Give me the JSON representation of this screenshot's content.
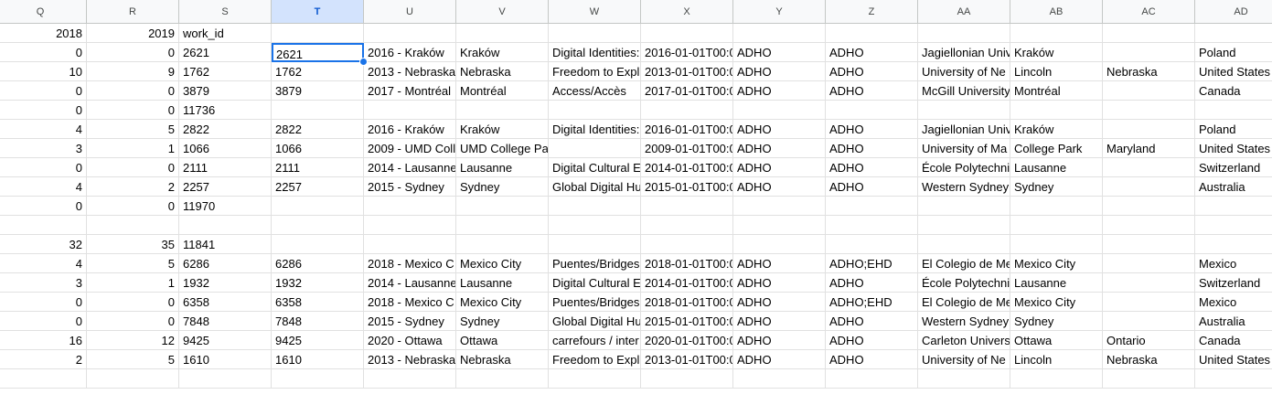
{
  "app": {
    "accent_color": "#1a73e8",
    "selected_header_bg": "#d3e3fd"
  },
  "columns": [
    "Q",
    "R",
    "S",
    "T",
    "U",
    "V",
    "W",
    "X",
    "Y",
    "Z",
    "AA",
    "AB",
    "AC",
    "AD"
  ],
  "selected_column": "T",
  "active_cell": {
    "row": 1,
    "col": 3
  },
  "rows": [
    [
      "2018",
      "2019",
      "work_id",
      "",
      "",
      "",
      "",
      "",
      "",
      "",
      "",
      "",
      "",
      ""
    ],
    [
      "0",
      "0",
      "2621",
      "2621",
      "2016 - Kraków",
      "Kraków",
      "Digital Identities:",
      "2016-01-01T00:0",
      "ADHO",
      "ADHO",
      "Jagiellonian Univ",
      "Kraków",
      "",
      "Poland"
    ],
    [
      "10",
      "9",
      "1762",
      "1762",
      "2013 - Nebraska",
      "Nebraska",
      "Freedom to Expl",
      "2013-01-01T00:0",
      "ADHO",
      "ADHO",
      "University of Ne",
      "Lincoln",
      "Nebraska",
      "United States"
    ],
    [
      "0",
      "0",
      "3879",
      "3879",
      "2017 - Montréal",
      "Montréal",
      "Access/Accès",
      "2017-01-01T00:0",
      "ADHO",
      "ADHO",
      "McGill University",
      "Montréal",
      "",
      "Canada"
    ],
    [
      "0",
      "0",
      "11736",
      "",
      "",
      "",
      "",
      "",
      "",
      "",
      "",
      "",
      "",
      ""
    ],
    [
      "4",
      "5",
      "2822",
      "2822",
      "2016 - Kraków",
      "Kraków",
      "Digital Identities:",
      "2016-01-01T00:0",
      "ADHO",
      "ADHO",
      "Jagiellonian Univ",
      "Kraków",
      "",
      "Poland"
    ],
    [
      "3",
      "1",
      "1066",
      "1066",
      "2009 - UMD Coll",
      "UMD College Pa",
      "",
      "2009-01-01T00:0",
      "ADHO",
      "ADHO",
      "University of Ma",
      "College Park",
      "Maryland",
      "United States"
    ],
    [
      "0",
      "0",
      "2111",
      "2111",
      "2014 - Lausanne",
      "Lausanne",
      "Digital Cultural E",
      "2014-01-01T00:0",
      "ADHO",
      "ADHO",
      "École Polytechni",
      "Lausanne",
      "",
      "Switzerland"
    ],
    [
      "4",
      "2",
      "2257",
      "2257",
      "2015 - Sydney",
      "Sydney",
      "Global Digital Hu",
      "2015-01-01T00:0",
      "ADHO",
      "ADHO",
      "Western Sydney",
      "Sydney",
      "",
      "Australia"
    ],
    [
      "0",
      "0",
      "11970",
      "",
      "",
      "",
      "",
      "",
      "",
      "",
      "",
      "",
      "",
      ""
    ],
    [
      "",
      "",
      "",
      "",
      "",
      "",
      "",
      "",
      "",
      "",
      "",
      "",
      "",
      ""
    ],
    [
      "32",
      "35",
      "11841",
      "",
      "",
      "",
      "",
      "",
      "",
      "",
      "",
      "",
      "",
      ""
    ],
    [
      "4",
      "5",
      "6286",
      "6286",
      "2018 - Mexico C",
      "Mexico City",
      "Puentes/Bridges",
      "2018-01-01T00:0",
      "ADHO",
      "ADHO;EHD",
      "El Colegio de Me",
      "Mexico City",
      "",
      "Mexico"
    ],
    [
      "3",
      "1",
      "1932",
      "1932",
      "2014 - Lausanne",
      "Lausanne",
      "Digital Cultural E",
      "2014-01-01T00:0",
      "ADHO",
      "ADHO",
      "École Polytechni",
      "Lausanne",
      "",
      "Switzerland"
    ],
    [
      "0",
      "0",
      "6358",
      "6358",
      "2018 - Mexico C",
      "Mexico City",
      "Puentes/Bridges",
      "2018-01-01T00:0",
      "ADHO",
      "ADHO;EHD",
      "El Colegio de Me",
      "Mexico City",
      "",
      "Mexico"
    ],
    [
      "0",
      "0",
      "7848",
      "7848",
      "2015 - Sydney",
      "Sydney",
      "Global Digital Hu",
      "2015-01-01T00:0",
      "ADHO",
      "ADHO",
      "Western Sydney",
      "Sydney",
      "",
      "Australia"
    ],
    [
      "16",
      "12",
      "9425",
      "9425",
      "2020 - Ottawa",
      "Ottawa",
      "carrefours / inter",
      "2020-01-01T00:0",
      "ADHO",
      "ADHO",
      "Carleton Univers",
      "Ottawa",
      "Ontario",
      "Canada"
    ],
    [
      "2",
      "5",
      "1610",
      "1610",
      "2013 - Nebraska",
      "Nebraska",
      "Freedom to Expl",
      "2013-01-01T00:0",
      "ADHO",
      "ADHO",
      "University of Ne",
      "Lincoln",
      "Nebraska",
      "United States"
    ],
    [
      "",
      "",
      "",
      "",
      "",
      "",
      "",
      "",
      "",
      "",
      "",
      "",
      "",
      ""
    ]
  ]
}
